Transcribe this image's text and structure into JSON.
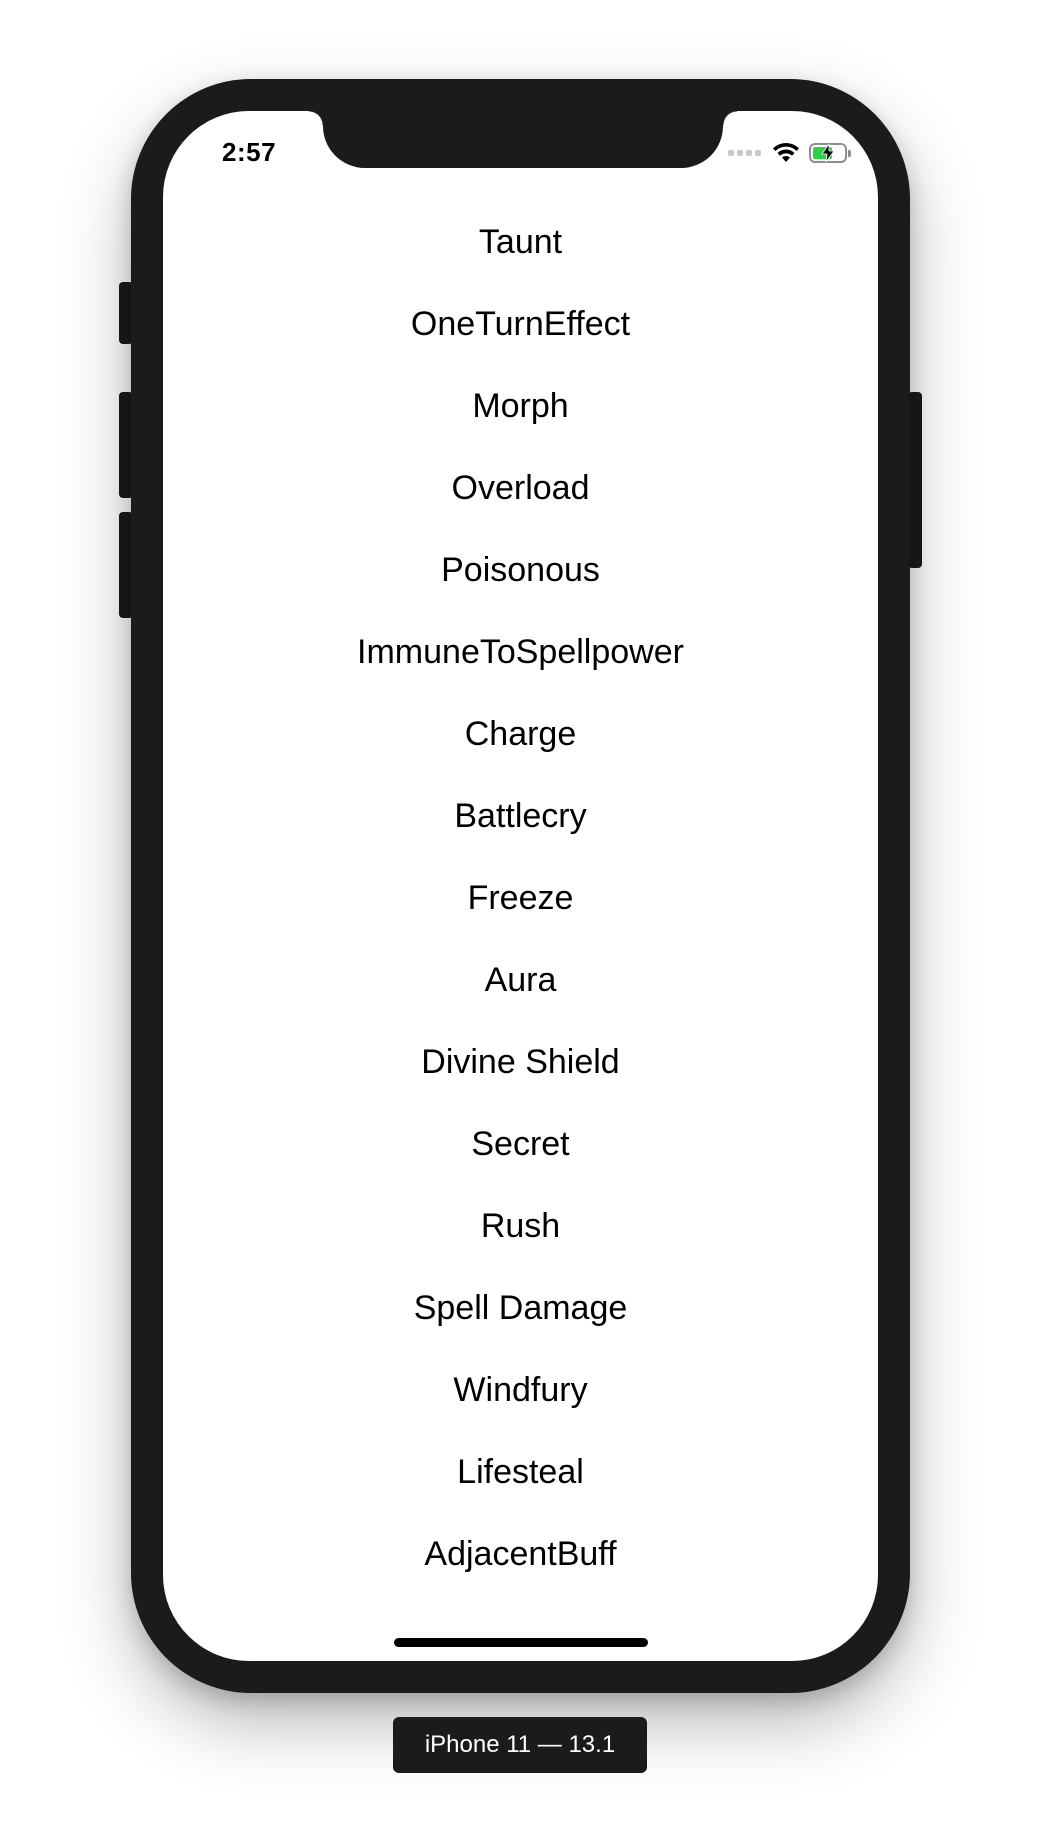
{
  "status_bar": {
    "time": "2:57",
    "icons": [
      "cellular-signal-icon",
      "wifi-icon",
      "battery-charging-icon"
    ],
    "battery_color": "#2fcf4a"
  },
  "list": {
    "items": [
      "Taunt",
      "OneTurnEffect",
      "Morph",
      "Overload",
      "Poisonous",
      "ImmuneToSpellpower",
      "Charge",
      "Battlecry",
      "Freeze",
      "Aura",
      "Divine Shield",
      "Secret",
      "Rush",
      "Spell Damage",
      "Windfury",
      "Lifesteal",
      "AdjacentBuff"
    ]
  },
  "device": {
    "label": "iPhone 11 — 13.1"
  }
}
